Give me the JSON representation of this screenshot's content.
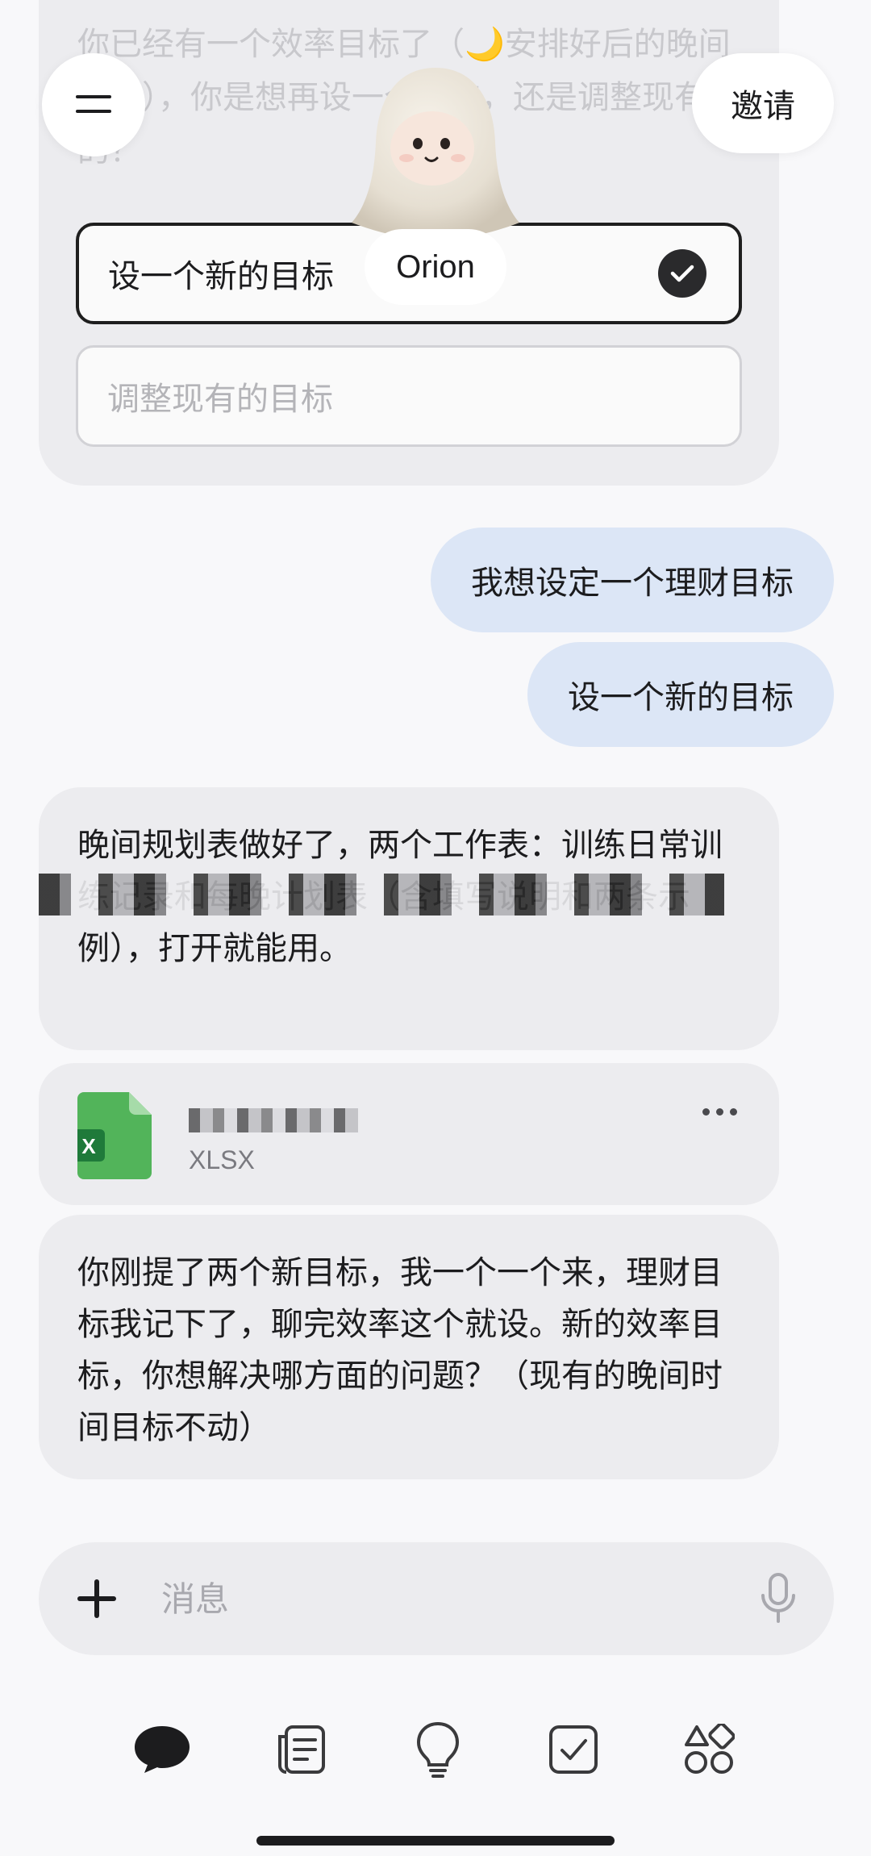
{
  "header": {
    "invite_label": "邀请",
    "assistant_name": "Orion"
  },
  "prompt_card": {
    "question": "你已经有一个效率目标了（🌙安排好后的晚间时间），你是想再设一个新的，还是调整现有的？",
    "options": [
      {
        "label": "设一个新的目标",
        "selected": true
      },
      {
        "label": "调整现有的目标",
        "selected": false
      }
    ]
  },
  "messages": {
    "user_1": "我想设定一个理财目标",
    "user_2": "设一个新的目标",
    "bot_1": "晚间规划表做好了，两个工作表：训练日常训练记录和每晚计划表（含填写说明和两条示例），打开就能用。",
    "bot_3": "你刚提了两个新目标，我一个一个来，理财目标我记下了，聊完效率这个就设。新的效率目标，你想解决哪方面的问题？（现有的晚间时间目标不动）"
  },
  "file": {
    "type": "XLSX"
  },
  "input": {
    "placeholder": "消息"
  },
  "nav": {
    "items": [
      "chat-icon",
      "notes-icon",
      "ideas-icon",
      "tasks-icon",
      "apps-icon"
    ]
  },
  "colors": {
    "user_bubble": "#dce6f6",
    "bot_bubble": "#ececef",
    "excel_green": "#4caf50"
  }
}
